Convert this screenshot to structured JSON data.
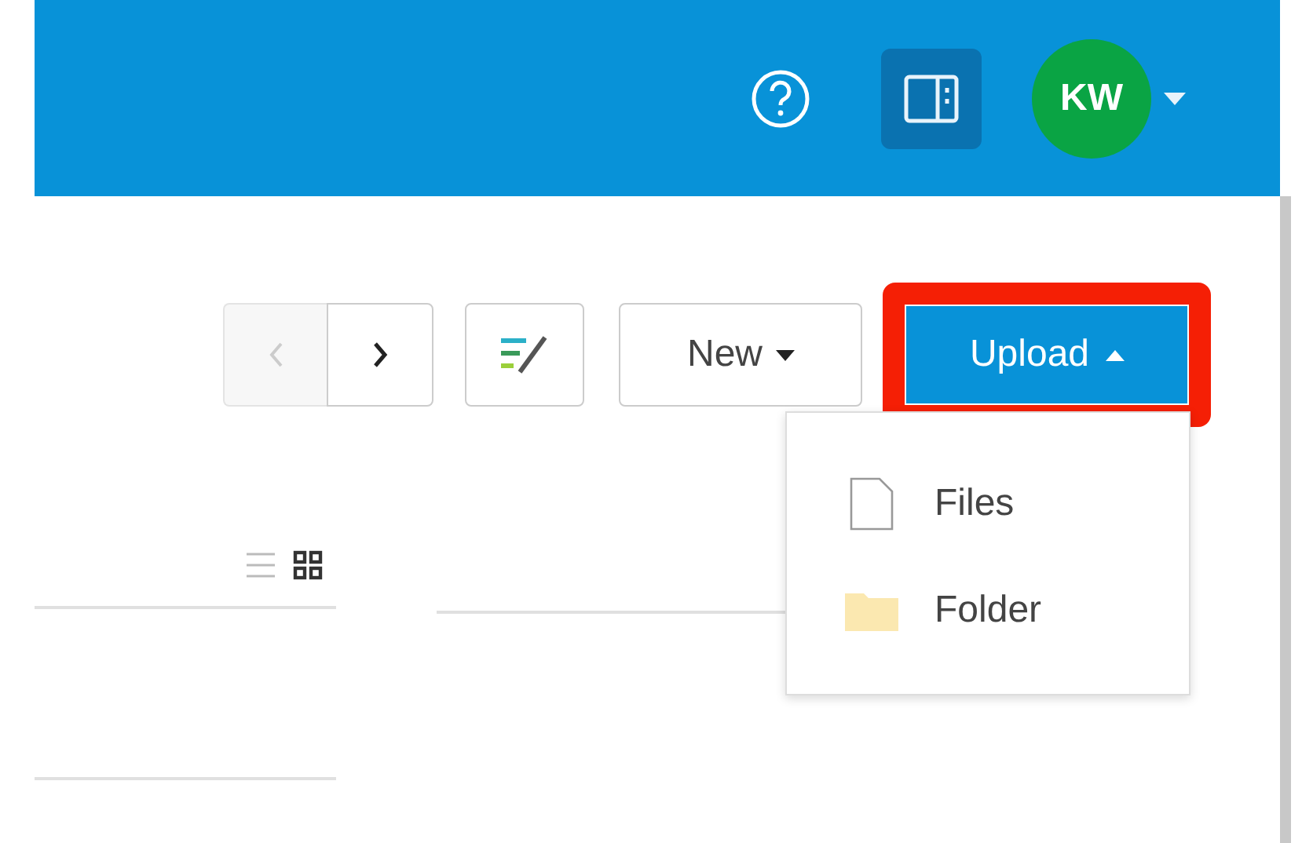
{
  "header": {
    "avatar": {
      "initials": "KW"
    },
    "panel_toggle": {
      "selected": true
    }
  },
  "toolbar": {
    "back": {
      "disabled": true
    },
    "forward": {
      "disabled": false
    },
    "new_button": {
      "label": "New"
    },
    "upload_button": {
      "label": "Upload",
      "expanded": true,
      "highlighted": true
    }
  },
  "view_toggle": [
    {
      "kind": "list",
      "selected": false
    },
    {
      "kind": "grid",
      "selected": true
    }
  ],
  "upload_menu": [
    {
      "kind": "file",
      "label": "Files"
    },
    {
      "kind": "folder",
      "label": "Folder"
    }
  ]
}
